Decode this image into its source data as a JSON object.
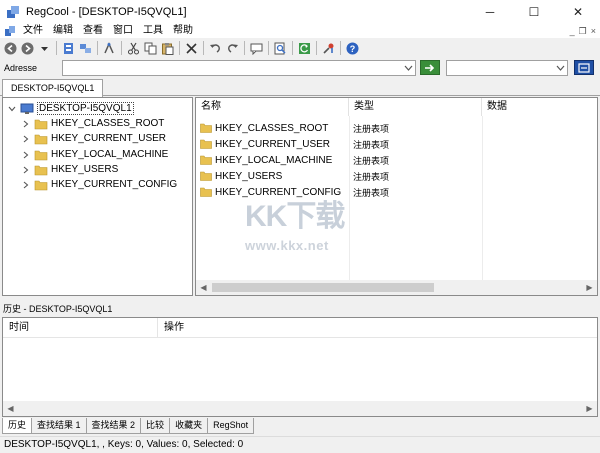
{
  "window": {
    "title": "RegCool - [DESKTOP-I5QVQL1]",
    "minimize": "─",
    "maximize": "☐",
    "close": "✕"
  },
  "menu": {
    "items": [
      "文件",
      "编辑",
      "查看",
      "窗口",
      "工具",
      "帮助"
    ],
    "mdi_minimize": "_",
    "mdi_restore": "❐",
    "mdi_close": "×"
  },
  "address": {
    "label": "Adresse",
    "value": ""
  },
  "doc_tab": "DESKTOP-I5QVQL1",
  "tree": {
    "root": "DESKTOP-I5QVQL1",
    "children": [
      "HKEY_CLASSES_ROOT",
      "HKEY_CURRENT_USER",
      "HKEY_LOCAL_MACHINE",
      "HKEY_USERS",
      "HKEY_CURRENT_CONFIG"
    ]
  },
  "list": {
    "columns": [
      "名称",
      "类型",
      "数据"
    ],
    "rows": [
      {
        "name": "HKEY_CLASSES_ROOT",
        "type": "注册表项"
      },
      {
        "name": "HKEY_CURRENT_USER",
        "type": "注册表项"
      },
      {
        "name": "HKEY_LOCAL_MACHINE",
        "type": "注册表项"
      },
      {
        "name": "HKEY_USERS",
        "type": "注册表项"
      },
      {
        "name": "HKEY_CURRENT_CONFIG",
        "type": "注册表项"
      }
    ]
  },
  "watermark": {
    "big": "KK下载",
    "small": "www.kkx.net"
  },
  "history": {
    "label": "历史 - DESKTOP-I5QVQL1",
    "col_time": "时间",
    "col_op": "操作"
  },
  "bottom_tabs": [
    "历史",
    "查找结果 1",
    "查找结果 2",
    "比较",
    "收藏夹",
    "RegShot"
  ],
  "status": "DESKTOP-I5QVQL1, , Keys: 0, Values: 0, Selected: 0",
  "colors": {
    "folder": "#e8c150",
    "go_button": "#3a8e3a",
    "search_button": "#1f4fa5"
  }
}
